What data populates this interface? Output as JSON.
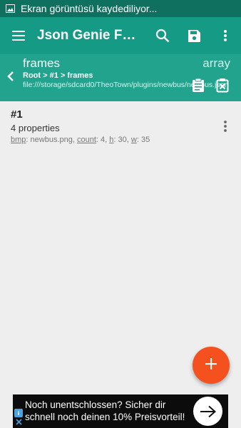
{
  "status_bar": {
    "text": "Ekran görüntüsü kaydediliyor...",
    "icon": "image-icon"
  },
  "app_bar": {
    "title": "Json Genie FRâ€¦",
    "actions": [
      "search-icon",
      "save-icon",
      "more-vert-icon"
    ]
  },
  "path_bar": {
    "node_name": "frames",
    "node_type": "array",
    "breadcrumb": "Root > #1 > frames",
    "file_path": "file:///storage/sdcard0/TheoTown/plugins/newbus/newbus.json",
    "actions": [
      "clipboard-icon",
      "clear-clipboard-icon"
    ]
  },
  "items": [
    {
      "label": "#1",
      "subtitle": "4 properties",
      "fields": [
        {
          "key": "bmp",
          "value": "newbus.png"
        },
        {
          "key": "count",
          "value": "4"
        },
        {
          "key": "h",
          "value": "30"
        },
        {
          "key": "w",
          "value": "35"
        }
      ]
    }
  ],
  "fab": {
    "icon": "plus-icon"
  },
  "ad": {
    "text": "Noch unentschlossen? Sicher dir schnell noch deinen 10% Preisvorteil!",
    "info_icon": "info-icon",
    "close_icon": "close-icon",
    "cta_icon": "arrow-right-icon"
  },
  "colors": {
    "status": "#10705f",
    "primary": "#159a86",
    "path": "#21a38e",
    "accent": "#f4511e"
  }
}
